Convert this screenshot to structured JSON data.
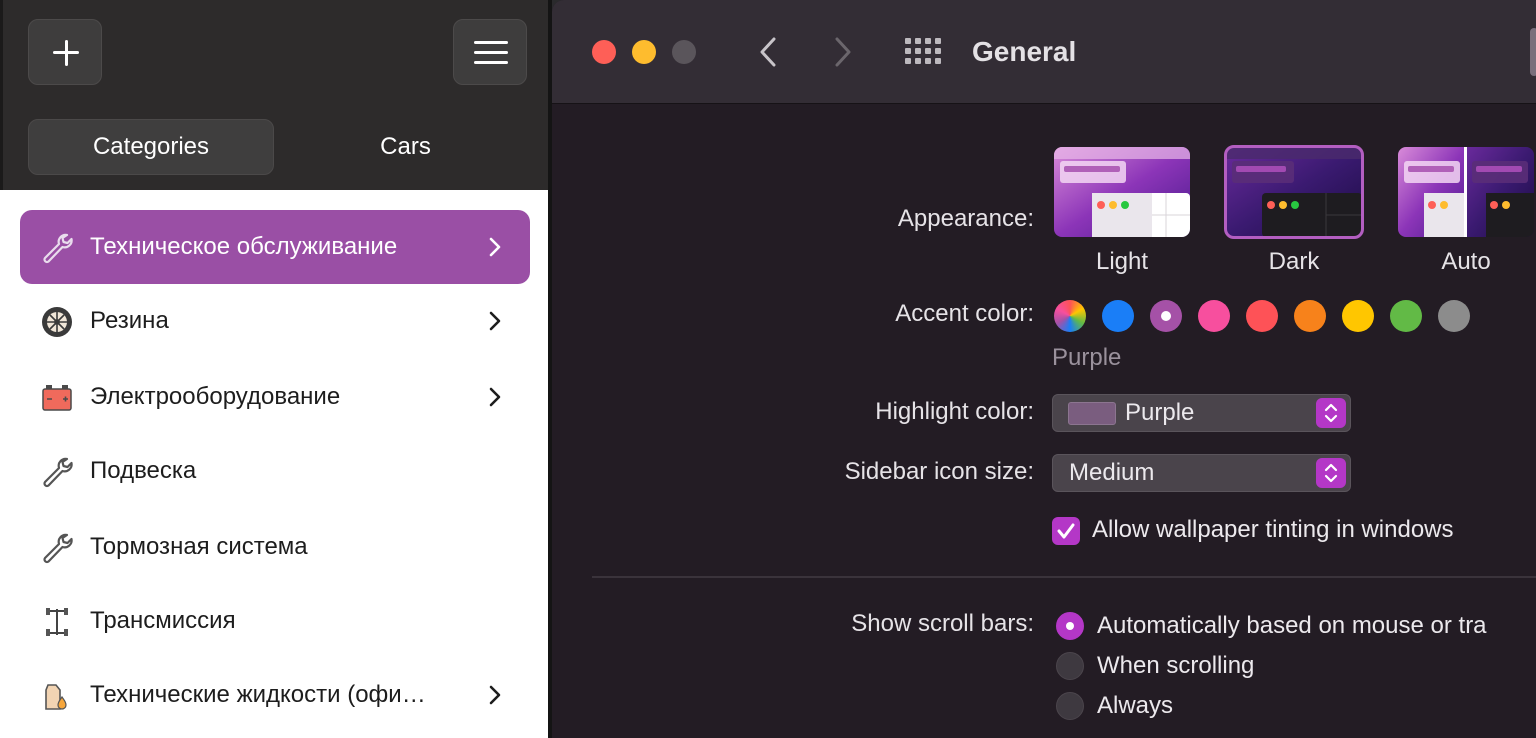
{
  "left_app": {
    "tabs": [
      "Categories",
      "Cars"
    ],
    "categories": [
      {
        "label": "Техническое обслуживание",
        "icon": "wrench-icon",
        "active": true,
        "chevron": true
      },
      {
        "label": "Резина",
        "icon": "tire-icon",
        "active": false,
        "chevron": true
      },
      {
        "label": "Электрооборудование",
        "icon": "battery-icon",
        "active": false,
        "chevron": true
      },
      {
        "label": "Подвеска",
        "icon": "wrench-icon",
        "active": false,
        "chevron": false
      },
      {
        "label": "Тормозная система",
        "icon": "wrench-icon",
        "active": false,
        "chevron": false
      },
      {
        "label": "Трансмиссия",
        "icon": "transmission-icon",
        "active": false,
        "chevron": false
      },
      {
        "label": "Технические жидкости (офи…",
        "icon": "fluids-icon",
        "active": false,
        "chevron": true
      }
    ],
    "accent_color": "#9a4fa5"
  },
  "prefs": {
    "title": "General",
    "appearance": {
      "label": "Appearance:",
      "options": [
        "Light",
        "Dark",
        "Auto"
      ],
      "selected": "Dark"
    },
    "accent": {
      "label": "Accent color:",
      "selected_name": "Purple",
      "colors": [
        "multicolor",
        "#1a7ef7",
        "#a551a7",
        "#f74f9e",
        "#fe5257",
        "#f7821b",
        "#ffc600",
        "#62ba46",
        "#8c8c8c"
      ],
      "selected_index": 2
    },
    "highlight": {
      "label": "Highlight color:",
      "value": "Purple"
    },
    "sidebar_icon_size": {
      "label": "Sidebar icon size:",
      "value": "Medium"
    },
    "tinting": {
      "label": "Allow wallpaper tinting in windows",
      "checked": true
    },
    "scroll_bars": {
      "label": "Show scroll bars:",
      "options": [
        "Automatically based on mouse or tra",
        "When scrolling",
        "Always"
      ],
      "selected_index": 0
    }
  }
}
